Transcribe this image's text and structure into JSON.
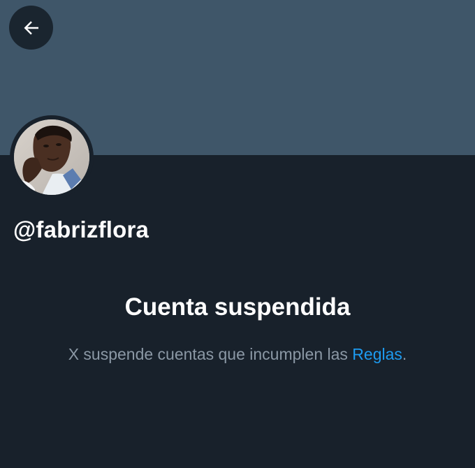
{
  "header": {
    "back_button_label": "Back"
  },
  "profile": {
    "handle": "@fabrizflora"
  },
  "suspension": {
    "title": "Cuenta suspendida",
    "message_prefix": "X suspende cuentas que incumplen las ",
    "rules_link": "Reglas",
    "message_suffix": "."
  },
  "colors": {
    "banner": "#3f5669",
    "background": "#18212b",
    "link": "#1d9bf0",
    "muted_text": "#8b98a5"
  },
  "icons": {
    "back": "arrow-left-icon"
  }
}
